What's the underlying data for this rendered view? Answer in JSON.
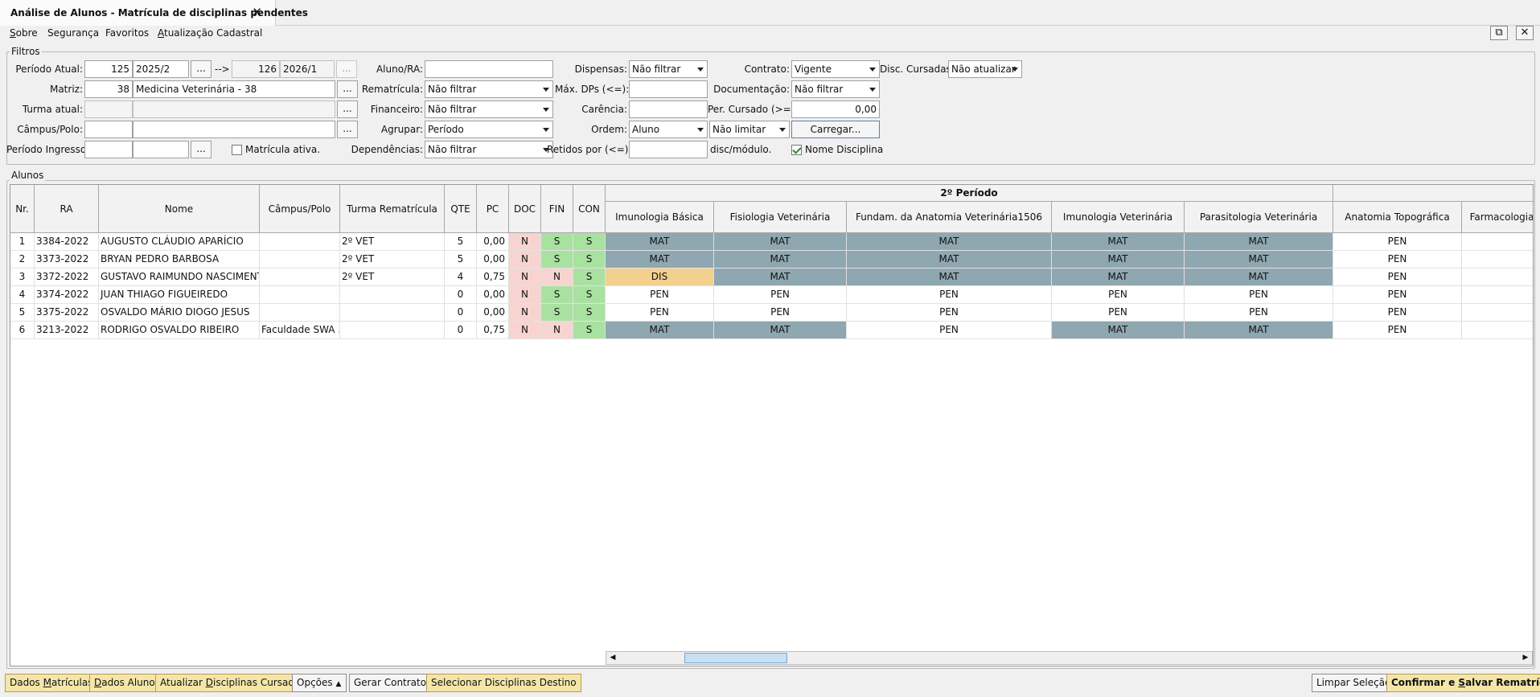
{
  "tab": {
    "title": "Análise de Alunos - Matrícula de disciplinas pendentes",
    "close": "✕"
  },
  "menu": [
    {
      "label": "Sobre",
      "u": "S",
      "rest": "obre"
    },
    {
      "label": "Segurança"
    },
    {
      "label": "Favoritos"
    },
    {
      "label": "Atualização Cadastral",
      "u": "A",
      "rest": "tualização Cadastral"
    }
  ],
  "window_buttons": {
    "detach": "⧉",
    "close": "✕"
  },
  "filters": {
    "title": "Filtros",
    "periodo_atual": {
      "label": "Período Atual:",
      "code": "125",
      "value": "2025/2",
      "arrow": "-->",
      "code2": "126",
      "value2": "2026/1"
    },
    "matriz": {
      "label": "Matriz:",
      "code": "38",
      "value": "Medicina Veterinária - 38"
    },
    "turma_atual": {
      "label": "Turma atual:",
      "code": "",
      "value": ""
    },
    "campus_polo": {
      "label": "Câmpus/Polo:",
      "code": "",
      "value": ""
    },
    "periodo_ingresso": {
      "label": "Período Ingresso:",
      "v1": "",
      "v2": ""
    },
    "matricula_ativa": {
      "label": "Matrícula ativa.",
      "checked": false
    },
    "aluno_ra": {
      "label": "Aluno/RA:",
      "value": ""
    },
    "rematricula": {
      "label": "Rematrícula:",
      "value": "Não filtrar"
    },
    "financeiro": {
      "label": "Financeiro:",
      "value": "Não filtrar"
    },
    "agrupar": {
      "label": "Agrupar:",
      "value": "Período"
    },
    "dependencias": {
      "label": "Dependências:",
      "value": "Não filtrar"
    },
    "dispensas": {
      "label": "Dispensas:",
      "value": "Não filtrar"
    },
    "max_dps": {
      "label": "Máx. DPs (<=):",
      "value": ""
    },
    "carencia": {
      "label": "Carência:",
      "value": ""
    },
    "ordem": {
      "label": "Ordem:",
      "value": "Aluno",
      "limit": "Não limitar"
    },
    "retidos": {
      "label": "Retidos por (<=):",
      "value": "",
      "suffix": "disc/módulo."
    },
    "contrato": {
      "label": "Contrato:",
      "value": "Vigente"
    },
    "documentacao": {
      "label": "Documentação:",
      "value": "Não filtrar"
    },
    "per_cursado": {
      "label": "Per. Cursado (>=):",
      "value": "0,00"
    },
    "carregar": "Carregar...",
    "nome_disciplina": {
      "label": "Nome Disciplina",
      "checked": true
    },
    "disc_cursadas": {
      "label": "Disc. Cursadas:",
      "value": "Não atualizar"
    },
    "dots": "..."
  },
  "alunos": {
    "title": "Alunos",
    "group_header": "2º Período",
    "columns": [
      "Nr.",
      "RA",
      "Nome",
      "Câmpus/Polo",
      "Turma Rematrícula",
      "QTE",
      "PC",
      "DOC",
      "FIN",
      "CON"
    ],
    "discipline_columns": [
      "Imunologia Básica",
      "Fisiologia Veterinária",
      "Fundam. da Anatomia Veterinária1506",
      "Imunologia Veterinária",
      "Parasitologia Veterinária",
      "Anatomia Topográfica",
      "Farmacologia"
    ],
    "rows": [
      {
        "nr": "1",
        "ra": "3384-2022",
        "nome": "AUGUSTO CLÁUDIO APARÍCIO",
        "campus": "",
        "turma": "2º VET",
        "qte": "5",
        "pc": "0,00",
        "doc": "N",
        "fin": "S",
        "con": "S",
        "disc": [
          "MAT",
          "MAT",
          "MAT",
          "MAT",
          "MAT",
          "PEN",
          ""
        ]
      },
      {
        "nr": "2",
        "ra": "3373-2022",
        "nome": "BRYAN PEDRO BARBOSA",
        "campus": "",
        "turma": "2º VET",
        "qte": "5",
        "pc": "0,00",
        "doc": "N",
        "fin": "S",
        "con": "S",
        "disc": [
          "MAT",
          "MAT",
          "MAT",
          "MAT",
          "MAT",
          "PEN",
          ""
        ]
      },
      {
        "nr": "3",
        "ra": "3372-2022",
        "nome": "GUSTAVO RAIMUNDO NASCIMENTO",
        "campus": "",
        "turma": "2º VET",
        "qte": "4",
        "pc": "0,75",
        "doc": "N",
        "fin": "N",
        "con": "S",
        "disc": [
          "DIS",
          "MAT",
          "MAT",
          "MAT",
          "MAT",
          "PEN",
          ""
        ]
      },
      {
        "nr": "4",
        "ra": "3374-2022",
        "nome": "JUAN THIAGO FIGUEIREDO",
        "campus": "",
        "turma": "",
        "qte": "0",
        "pc": "0,00",
        "doc": "N",
        "fin": "S",
        "con": "S",
        "disc": [
          "PEN",
          "PEN",
          "PEN",
          "PEN",
          "PEN",
          "PEN",
          ""
        ]
      },
      {
        "nr": "5",
        "ra": "3375-2022",
        "nome": "OSVALDO MÁRIO DIOGO JESUS",
        "campus": "",
        "turma": "",
        "qte": "0",
        "pc": "0,00",
        "doc": "N",
        "fin": "S",
        "con": "S",
        "disc": [
          "PEN",
          "PEN",
          "PEN",
          "PEN",
          "PEN",
          "PEN",
          ""
        ]
      },
      {
        "nr": "6",
        "ra": "3213-2022",
        "nome": "RODRIGO OSVALDO RIBEIRO",
        "campus": "Faculdade SWA ...",
        "turma": "",
        "qte": "0",
        "pc": "0,75",
        "doc": "N",
        "fin": "N",
        "con": "S",
        "disc": [
          "MAT",
          "MAT",
          "PEN",
          "MAT",
          "MAT",
          "PEN",
          ""
        ]
      }
    ]
  },
  "bottom": {
    "dados_matriculas": {
      "pre": "Dados ",
      "u": "M",
      "post": "atrículas"
    },
    "dados_aluno": {
      "pre": "",
      "u": "D",
      "post": "ados Aluno"
    },
    "atualizar": {
      "pre": "Atualizar ",
      "u": "D",
      "post": "isciplinas Cursadas"
    },
    "opcoes": "Opções",
    "gerar_contratos": "Gerar Contratos",
    "selecionar": "Selecionar Disciplinas Destino",
    "limpar": "Limpar Seleção",
    "confirmar": {
      "pre": "Confirmar e ",
      "u": "S",
      "post": "alvar Rematrículas"
    }
  },
  "colors": {
    "mat": "#8fa7b0",
    "pen": "#ffffff",
    "dis": "#f4d08e",
    "green": "#a9e2a0",
    "pink": "#f7d4d0",
    "yellow_btn": "#f4e6a8"
  }
}
